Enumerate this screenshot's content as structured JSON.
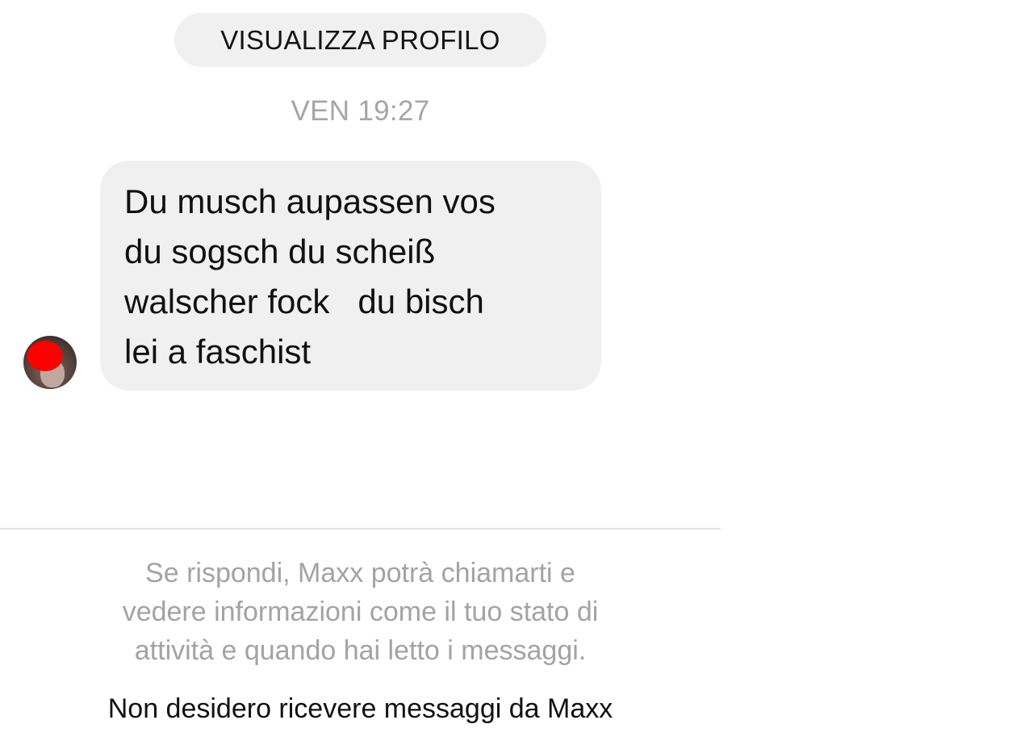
{
  "chat": {
    "view_profile_label": "VISUALIZZA PROFILO",
    "timestamp": "VEN 19:27",
    "message": {
      "lines": [
        "Du musch aupassen vos",
        "du sogsch du scheiß",
        "walscher fock   du bisch",
        "lei a faschist"
      ]
    }
  },
  "footer": {
    "notice_lines": [
      "Se rispondi, Maxx potrà chiamarti e",
      "vedere informazioni come il tuo stato di",
      "attività e quando hai letto i messaggi."
    ],
    "decline_label": "Non desidero ricevere messaggi da Maxx"
  },
  "colors": {
    "bubble_background": "#f0f0f0",
    "secondary_text": "#a6a6a6",
    "primary_text": "#111111",
    "avatar_redaction": "#ff0000"
  },
  "icons": {
    "avatar": "avatar-photo-redacted"
  }
}
